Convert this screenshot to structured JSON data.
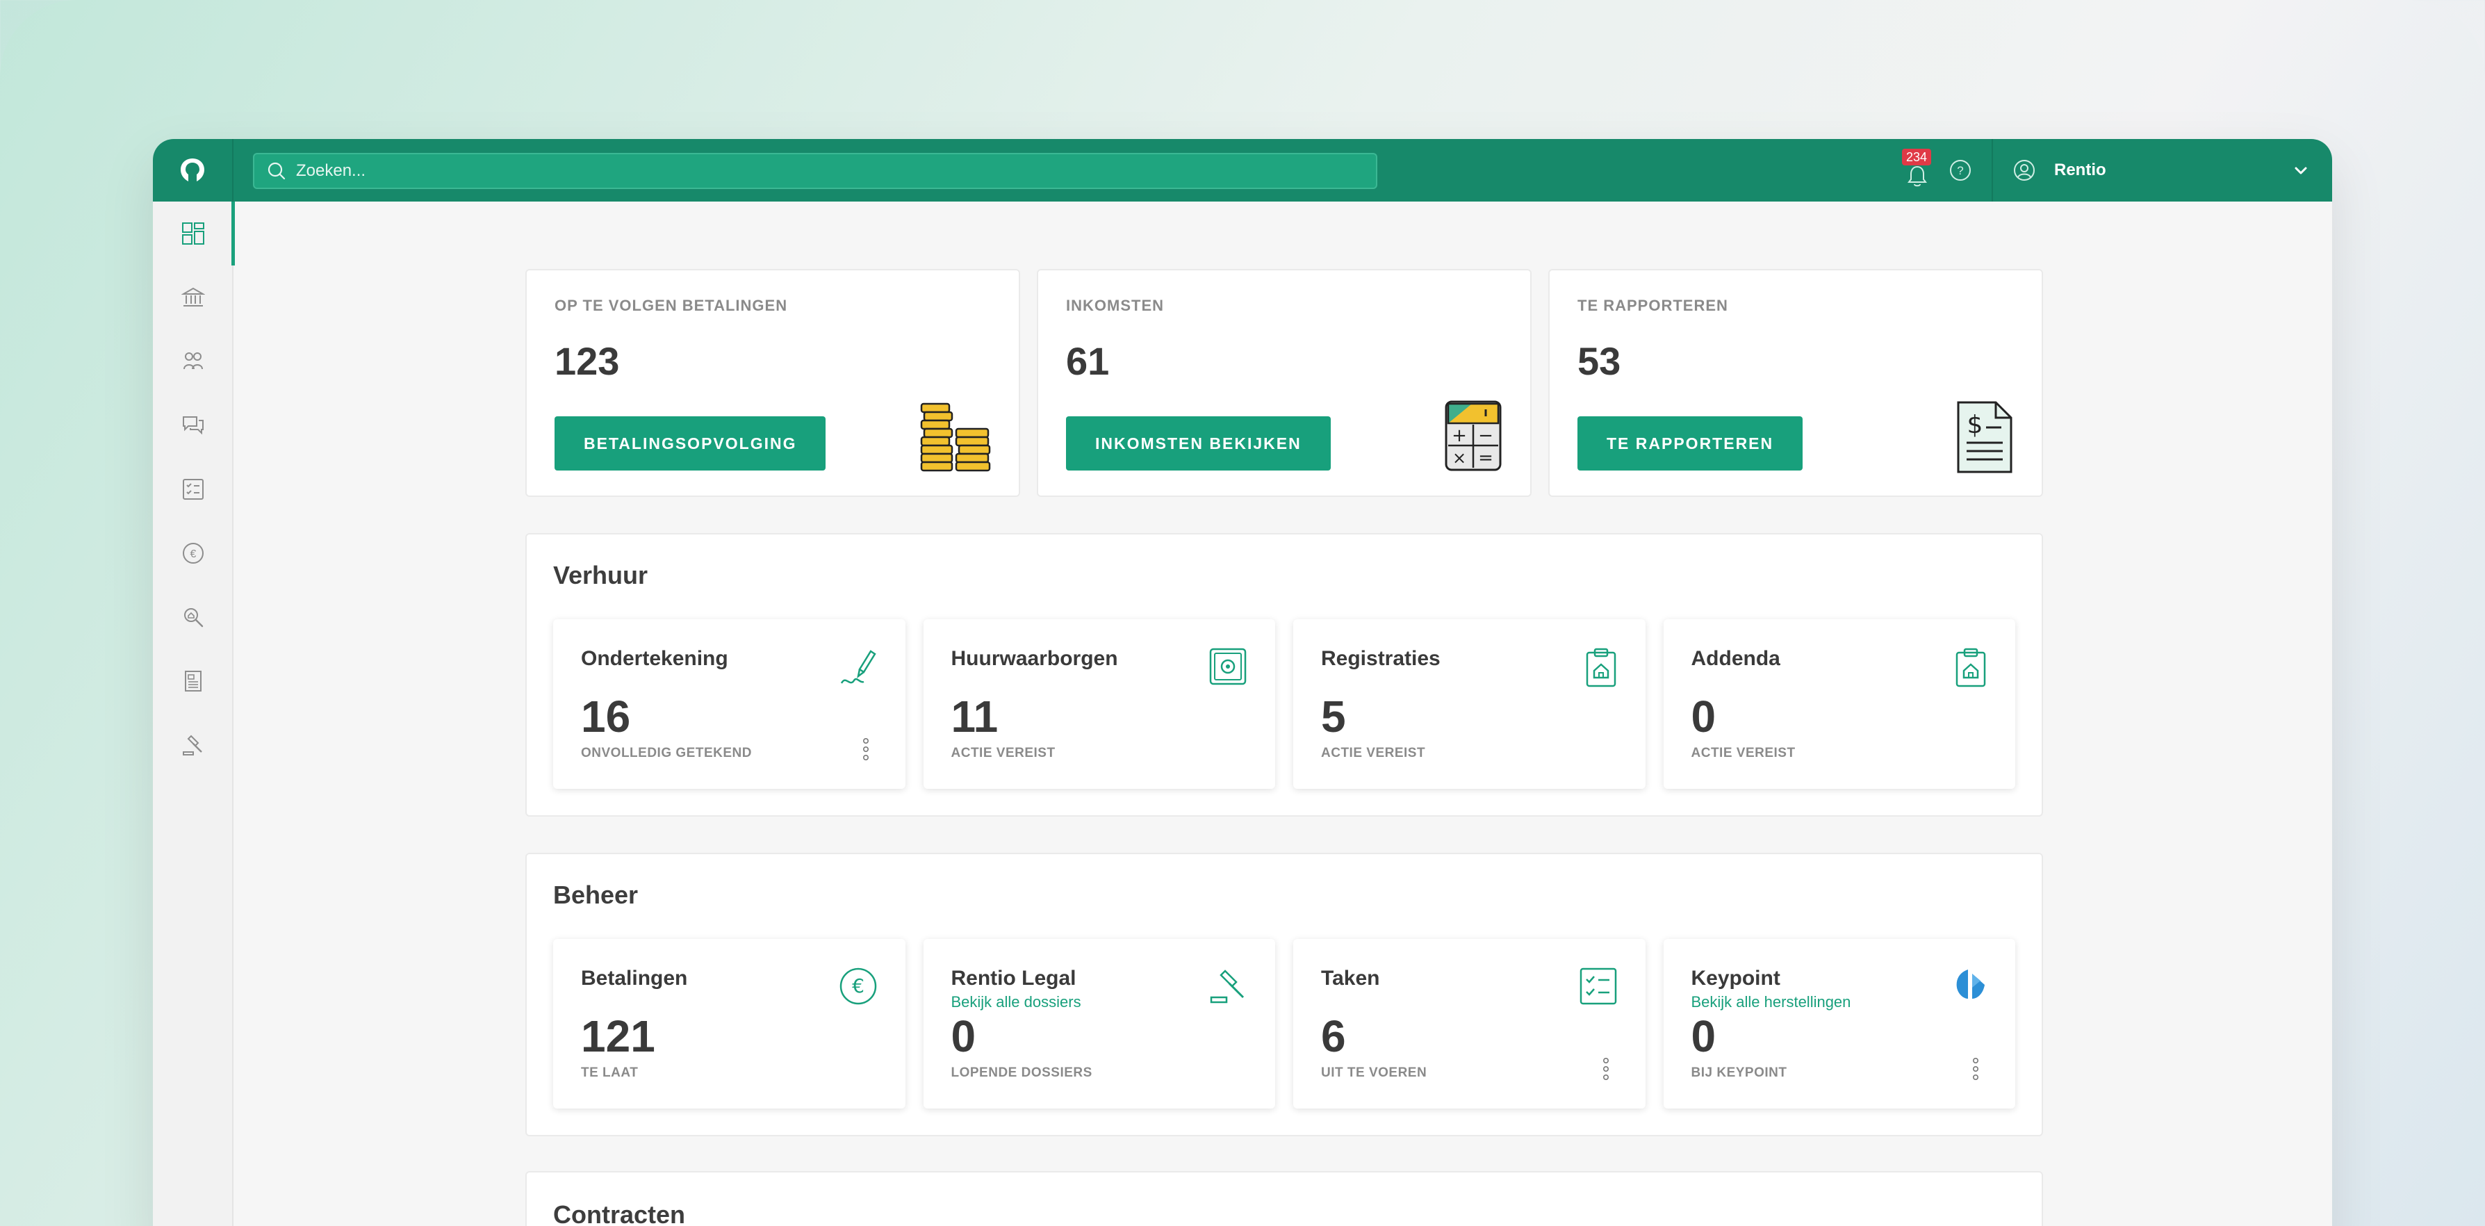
{
  "topbar": {
    "search_placeholder": "Zoeken...",
    "notifications_count": "234",
    "user_name": "Rentio"
  },
  "sidebar": {
    "items": [
      {
        "icon": "dashboard-icon",
        "active": true
      },
      {
        "icon": "bank-icon"
      },
      {
        "icon": "people-icon"
      },
      {
        "icon": "chat-icon"
      },
      {
        "icon": "checklist-icon"
      },
      {
        "icon": "euro-icon"
      },
      {
        "icon": "search-property-icon"
      },
      {
        "icon": "document-icon"
      },
      {
        "icon": "gavel-icon"
      }
    ]
  },
  "kpis": [
    {
      "label": "OP TE VOLGEN BETALINGEN",
      "value": "123",
      "button": "BETALINGSOPVOLGING",
      "icon": "coins-icon"
    },
    {
      "label": "INKOMSTEN",
      "value": "61",
      "button": "INKOMSTEN BEKIJKEN",
      "icon": "calculator-icon"
    },
    {
      "label": "TE RAPPORTEREN",
      "value": "53",
      "button": "TE RAPPORTEREN",
      "icon": "invoice-icon"
    }
  ],
  "verhuur": {
    "title": "Verhuur",
    "cards": [
      {
        "title": "Ondertekening",
        "value": "16",
        "label": "ONVOLLEDIG GETEKEND",
        "icon": "signature-icon"
      },
      {
        "title": "Huurwaarborgen",
        "value": "11",
        "label": "ACTIE VEREIST",
        "icon": "safe-icon"
      },
      {
        "title": "Registraties",
        "value": "5",
        "label": "ACTIE VEREIST",
        "icon": "clipboard-house-icon"
      },
      {
        "title": "Addenda",
        "value": "0",
        "label": "ACTIE VEREIST",
        "icon": "clipboard-house-icon"
      }
    ]
  },
  "beheer": {
    "title": "Beheer",
    "cards": [
      {
        "title": "Betalingen",
        "sub": "",
        "value": "121",
        "label": "TE LAAT",
        "icon": "euro-circle-icon"
      },
      {
        "title": "Rentio Legal",
        "sub": "Bekijk alle dossiers",
        "value": "0",
        "label": "LOPENDE DOSSIERS",
        "icon": "gavel-icon"
      },
      {
        "title": "Taken",
        "sub": "",
        "value": "6",
        "label": "UIT TE VOEREN",
        "icon": "checklist-icon"
      },
      {
        "title": "Keypoint",
        "sub": "Bekijk alle herstellingen",
        "value": "0",
        "label": "BIJ KEYPOINT",
        "icon": "keypoint-logo-icon"
      }
    ]
  },
  "contracten": {
    "title": "Contracten"
  },
  "colors": {
    "brand": "#17896a",
    "accent": "#18a07c",
    "badge": "#e03a46"
  }
}
